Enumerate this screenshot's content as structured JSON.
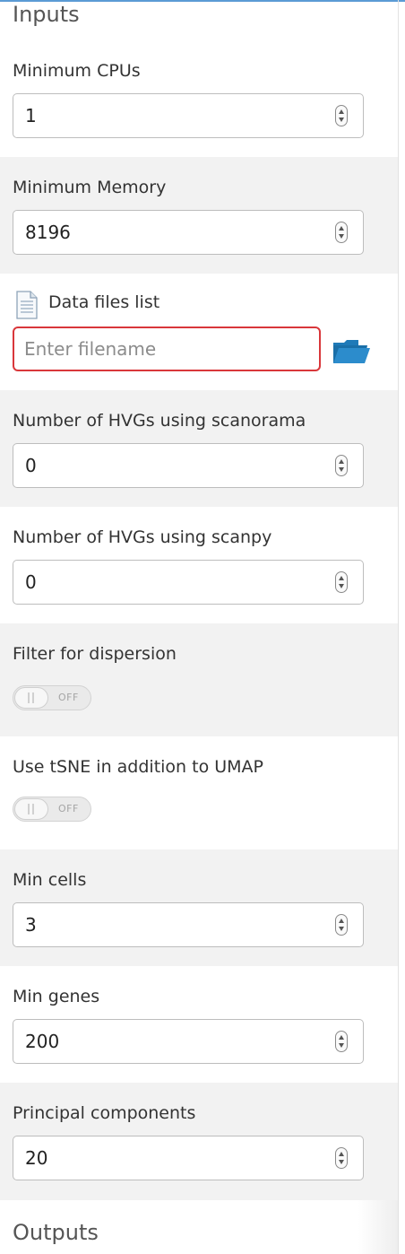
{
  "inputs_title": "Inputs",
  "outputs_title": "Outputs",
  "fields": {
    "min_cpus": {
      "label": "Minimum CPUs",
      "value": "1"
    },
    "min_memory": {
      "label": "Minimum Memory",
      "value": "8196"
    },
    "data_files": {
      "label": "Data files list",
      "placeholder": "Enter filename",
      "value": ""
    },
    "hvgs_scanorama": {
      "label": "Number of HVGs using scanorama",
      "value": "0"
    },
    "hvgs_scanpy": {
      "label": "Number of HVGs using scanpy",
      "value": "0"
    },
    "filter_dispersion": {
      "label": "Filter for dispersion",
      "state": "OFF"
    },
    "use_tsne": {
      "label": "Use tSNE in addition to UMAP",
      "state": "OFF"
    },
    "min_cells": {
      "label": "Min cells",
      "value": "3"
    },
    "min_genes": {
      "label": "Min genes",
      "value": "200"
    },
    "principal_components": {
      "label": "Principal components",
      "value": "20"
    }
  },
  "colors": {
    "row_gray": "#f2f2f2",
    "error_border": "#d9373b",
    "folder_blue": "#1a6fa8",
    "top_accent": "#5b9bd5"
  },
  "icons": {
    "file": "document-icon",
    "browse": "folder-open-icon",
    "spinner": "stepper-arrows-icon"
  }
}
